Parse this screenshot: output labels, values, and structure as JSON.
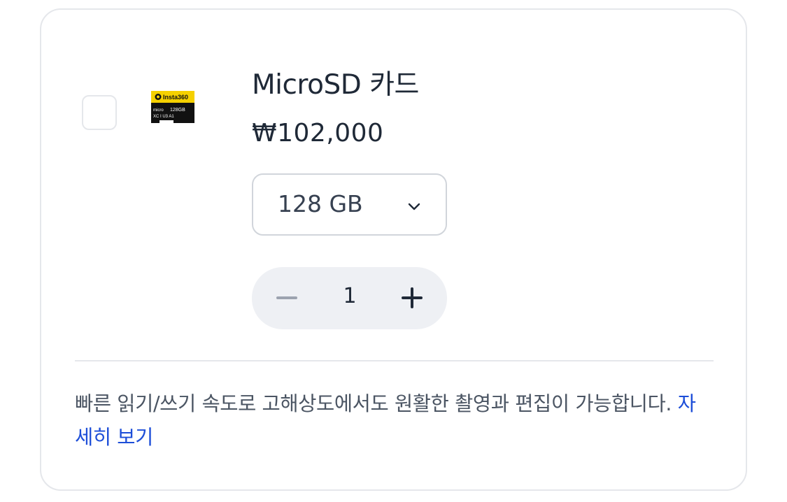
{
  "product": {
    "name": "MicroSD 카드",
    "price": "₩102,000",
    "thumbnail_icon": "microsd-card-thumbnail",
    "thumbnail_brand": "Insta360",
    "thumbnail_capacity": "128GB"
  },
  "option": {
    "selected": "128 GB",
    "icon": "chevron-down-icon"
  },
  "quantity": {
    "value": "1",
    "minus_icon": "minus-icon",
    "plus_icon": "plus-icon"
  },
  "description": {
    "text": "빠른 읽기/쓰기 속도로 고해상도에서도 원활한 촬영과 편집이 가능합니다. ",
    "link_label": "자세히 보기"
  },
  "colors": {
    "text_primary": "#1f2937",
    "link": "#1d4ed8",
    "border": "#e5e7eb",
    "stepper_bg": "#eef0f4"
  }
}
